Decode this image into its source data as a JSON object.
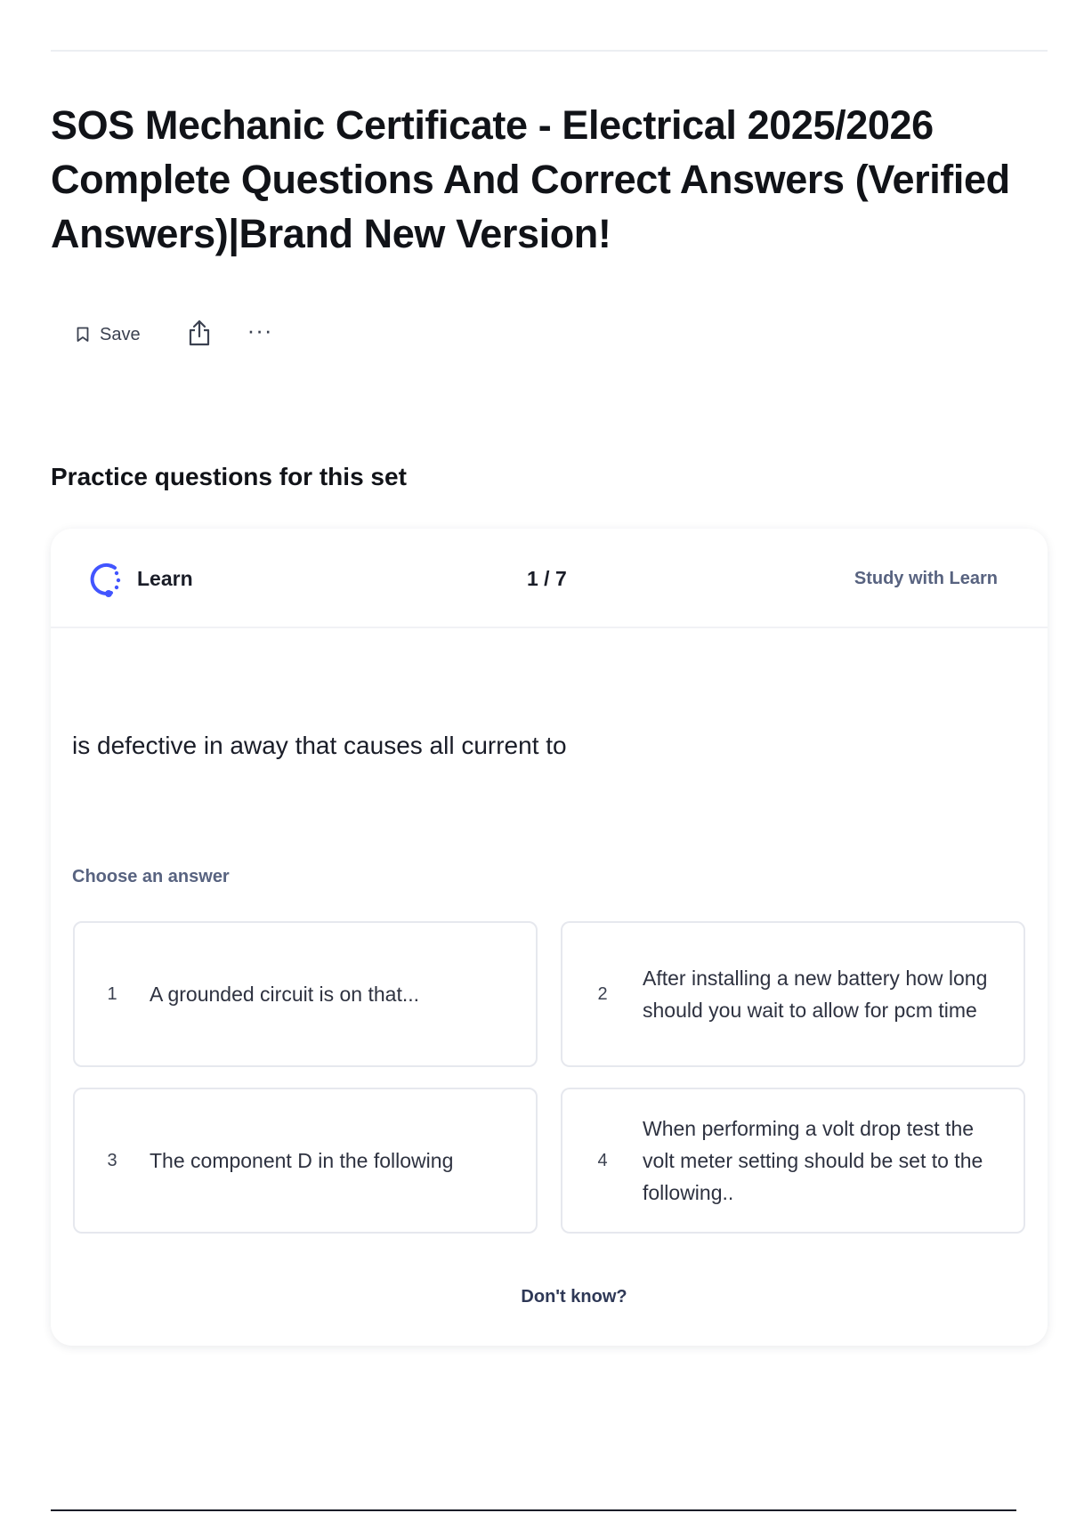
{
  "document": {
    "title": "SOS Mechanic Certificate - Electrical 2025/2026 Complete Questions And Correct Answers (Verified Answers)|Brand New Version!"
  },
  "actions": {
    "save_label": "Save",
    "icons": [
      "bookmark-icon",
      "share-icon",
      "more-icon"
    ]
  },
  "practice": {
    "heading": "Practice questions for this set",
    "mode_label": "Learn",
    "progress": "1 / 7",
    "progress_current": 1,
    "progress_total": 7,
    "study_link": "Study with Learn",
    "question": "is defective in away that causes all current to",
    "choose_label": "Choose an answer",
    "answers": [
      {
        "num": "1",
        "text": "A grounded circuit is on that..."
      },
      {
        "num": "2",
        "text": "After installing a new battery how long should you wait to allow for pcm time"
      },
      {
        "num": "3",
        "text": "The component D in the following"
      },
      {
        "num": "4",
        "text": "When performing a volt drop test the volt meter setting should be set to the following.."
      }
    ],
    "dont_know": "Don't know?"
  },
  "colors": {
    "accent": "#4255ff",
    "muted_text": "#586380",
    "link": "#2e3856",
    "border": "#e6e8ee"
  }
}
